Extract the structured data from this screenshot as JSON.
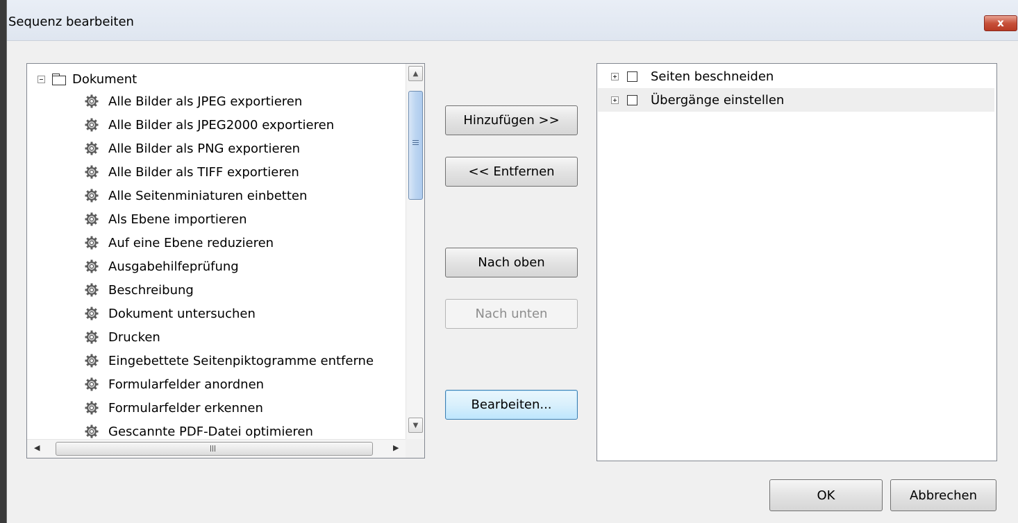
{
  "window": {
    "title": "Sequenz bearbeiten",
    "close_label": "x"
  },
  "commands_tree": {
    "root_label": "Dokument",
    "items": [
      "Alle Bilder als JPEG exportieren",
      "Alle Bilder als JPEG2000 exportieren",
      "Alle Bilder als PNG exportieren",
      "Alle Bilder als TIFF exportieren",
      "Alle Seitenminiaturen einbetten",
      "Als Ebene importieren",
      "Auf eine Ebene reduzieren",
      "Ausgabehilfeprüfung",
      "Beschreibung",
      "Dokument untersuchen",
      "Drucken",
      "Eingebettete Seitenpiktogramme entferne",
      "Formularfelder anordnen",
      "Formularfelder erkennen",
      "Gescannte PDF-Datei optimieren"
    ],
    "hscroll_grip": "III"
  },
  "buttons": {
    "add": "Hinzufügen >>",
    "remove": "<< Entfernen",
    "move_up": "Nach oben",
    "move_down": "Nach unten",
    "edit": "Bearbeiten...",
    "ok": "OK",
    "cancel": "Abbrechen"
  },
  "sequence": {
    "items": [
      "Seiten beschneiden",
      "Übergänge einstellen"
    ]
  }
}
